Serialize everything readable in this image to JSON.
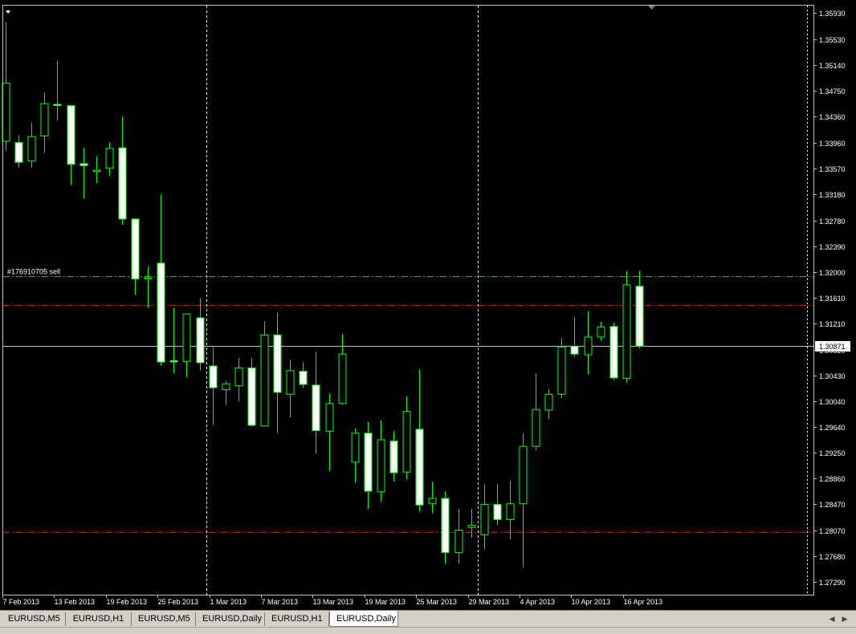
{
  "chart_data": {
    "type": "candlestick",
    "symbol": "EURUSD",
    "timeframe": "Daily",
    "y_ticks": [
      1.3593,
      1.3553,
      1.3514,
      1.3475,
      1.3436,
      1.3396,
      1.3357,
      1.3318,
      1.3278,
      1.3239,
      1.32,
      1.3161,
      1.3121,
      1.3082,
      1.3043,
      1.3004,
      1.2964,
      1.2925,
      1.2886,
      1.2847,
      1.2807,
      1.2768,
      1.2729
    ],
    "y_tick_labels": [
      "1.35930",
      "1.35530",
      "1.35140",
      "1.34750",
      "1.34360",
      "1.33960",
      "1.33570",
      "1.33180",
      "1.32780",
      "1.32390",
      "1.32000",
      "1.31610",
      "1.31210",
      "1.30820",
      "1.30430",
      "1.30040",
      "1.29640",
      "1.29250",
      "1.28860",
      "1.28470",
      "1.28070",
      "1.27680",
      "1.27290"
    ],
    "ylim": [
      1.271,
      1.3605
    ],
    "x_ticks": [
      {
        "index": 0,
        "label": "7 Feb 2013"
      },
      {
        "index": 4,
        "label": "13 Feb 2013"
      },
      {
        "index": 8,
        "label": "19 Feb 2013"
      },
      {
        "index": 12,
        "label": "25 Feb 2013"
      },
      {
        "index": 16,
        "label": "1 Mar 2013"
      },
      {
        "index": 20,
        "label": "7 Mar 2013"
      },
      {
        "index": 24,
        "label": "13 Mar 2013"
      },
      {
        "index": 28,
        "label": "19 Mar 2013"
      },
      {
        "index": 32,
        "label": "25 Mar 2013"
      },
      {
        "index": 36,
        "label": "29 Mar 2013"
      },
      {
        "index": 40,
        "label": "4 Apr 2013"
      },
      {
        "index": 44,
        "label": "10 Apr 2013"
      },
      {
        "index": 48,
        "label": "16 Apr 2013"
      }
    ],
    "candles": [
      {
        "o": 1.3398,
        "h": 1.3579,
        "l": 1.3384,
        "c": 1.3486
      },
      {
        "o": 1.3396,
        "h": 1.3407,
        "l": 1.3358,
        "c": 1.3366
      },
      {
        "o": 1.3368,
        "h": 1.3426,
        "l": 1.3358,
        "c": 1.3405
      },
      {
        "o": 1.3406,
        "h": 1.3472,
        "l": 1.338,
        "c": 1.3455
      },
      {
        "o": 1.3454,
        "h": 1.352,
        "l": 1.3429,
        "c": 1.3453
      },
      {
        "o": 1.3452,
        "h": 1.3453,
        "l": 1.3332,
        "c": 1.3363
      },
      {
        "o": 1.3364,
        "h": 1.3388,
        "l": 1.3311,
        "c": 1.3361
      },
      {
        "o": 1.3352,
        "h": 1.3375,
        "l": 1.3334,
        "c": 1.3354
      },
      {
        "o": 1.3357,
        "h": 1.3396,
        "l": 1.3345,
        "c": 1.3387
      },
      {
        "o": 1.3388,
        "h": 1.3435,
        "l": 1.3271,
        "c": 1.328
      },
      {
        "o": 1.328,
        "h": 1.3281,
        "l": 1.3165,
        "c": 1.3189
      },
      {
        "o": 1.3189,
        "h": 1.3208,
        "l": 1.3145,
        "c": 1.3191
      },
      {
        "o": 1.3213,
        "h": 1.3317,
        "l": 1.3058,
        "c": 1.3063
      },
      {
        "o": 1.3065,
        "h": 1.3145,
        "l": 1.3046,
        "c": 1.3065
      },
      {
        "o": 1.3064,
        "h": 1.3136,
        "l": 1.304,
        "c": 1.3136
      },
      {
        "o": 1.313,
        "h": 1.316,
        "l": 1.305,
        "c": 1.3062
      },
      {
        "o": 1.3057,
        "h": 1.3085,
        "l": 1.2968,
        "c": 1.3024
      },
      {
        "o": 1.3021,
        "h": 1.3034,
        "l": 1.2998,
        "c": 1.303
      },
      {
        "o": 1.3027,
        "h": 1.3069,
        "l": 1.3003,
        "c": 1.3054
      },
      {
        "o": 1.3054,
        "h": 1.3069,
        "l": 1.2965,
        "c": 1.2967
      },
      {
        "o": 1.2966,
        "h": 1.3124,
        "l": 1.2965,
        "c": 1.3104
      },
      {
        "o": 1.3104,
        "h": 1.3138,
        "l": 1.2955,
        "c": 1.3017
      },
      {
        "o": 1.3014,
        "h": 1.3066,
        "l": 1.2979,
        "c": 1.305
      },
      {
        "o": 1.3049,
        "h": 1.3063,
        "l": 1.3024,
        "c": 1.3029
      },
      {
        "o": 1.3028,
        "h": 1.3078,
        "l": 1.2924,
        "c": 1.2959
      },
      {
        "o": 1.2958,
        "h": 1.3015,
        "l": 1.2898,
        "c": 1.3
      },
      {
        "o": 1.3,
        "h": 1.3105,
        "l": 1.2998,
        "c": 1.3075
      },
      {
        "o": 1.2911,
        "h": 1.2962,
        "l": 1.288,
        "c": 1.2955
      },
      {
        "o": 1.2955,
        "h": 1.2972,
        "l": 1.284,
        "c": 1.2867
      },
      {
        "o": 1.2866,
        "h": 1.2975,
        "l": 1.2851,
        "c": 1.2945
      },
      {
        "o": 1.2943,
        "h": 1.2958,
        "l": 1.2882,
        "c": 1.2895
      },
      {
        "o": 1.2896,
        "h": 1.3011,
        "l": 1.2885,
        "c": 1.2988
      },
      {
        "o": 1.2961,
        "h": 1.3052,
        "l": 1.2836,
        "c": 1.2846
      },
      {
        "o": 1.2848,
        "h": 1.2881,
        "l": 1.2834,
        "c": 1.2856
      },
      {
        "o": 1.2856,
        "h": 1.2867,
        "l": 1.2757,
        "c": 1.2774
      },
      {
        "o": 1.2774,
        "h": 1.284,
        "l": 1.2757,
        "c": 1.2808
      },
      {
        "o": 1.2812,
        "h": 1.284,
        "l": 1.2796,
        "c": 1.2815
      },
      {
        "o": 1.2801,
        "h": 1.2878,
        "l": 1.2779,
        "c": 1.2847
      },
      {
        "o": 1.2847,
        "h": 1.2878,
        "l": 1.2815,
        "c": 1.2824
      },
      {
        "o": 1.2824,
        "h": 1.2883,
        "l": 1.2794,
        "c": 1.2848
      },
      {
        "o": 1.2848,
        "h": 1.2955,
        "l": 1.2751,
        "c": 1.2935
      },
      {
        "o": 1.2935,
        "h": 1.3046,
        "l": 1.2929,
        "c": 1.2991
      },
      {
        "o": 1.299,
        "h": 1.3022,
        "l": 1.2976,
        "c": 1.3014
      },
      {
        "o": 1.3014,
        "h": 1.3099,
        "l": 1.3008,
        "c": 1.3086
      },
      {
        "o": 1.3087,
        "h": 1.3131,
        "l": 1.3071,
        "c": 1.3075
      },
      {
        "o": 1.3074,
        "h": 1.314,
        "l": 1.3044,
        "c": 1.3101
      },
      {
        "o": 1.3101,
        "h": 1.3124,
        "l": 1.3095,
        "c": 1.3116
      },
      {
        "o": 1.3117,
        "h": 1.3123,
        "l": 1.3036,
        "c": 1.3039
      },
      {
        "o": 1.3038,
        "h": 1.3201,
        "l": 1.3032,
        "c": 1.318
      },
      {
        "o": 1.3178,
        "h": 1.3201,
        "l": 1.3084,
        "c": 1.3087
      }
    ],
    "bid_price": 1.30871,
    "bid_price_label": "1.30871",
    "lines": [
      {
        "kind": "order",
        "price": 1.3194,
        "color": "#00c000",
        "label": "#176910705 sell"
      },
      {
        "kind": "stop-level",
        "price": 1.315,
        "color": "#ff0000"
      },
      {
        "kind": "stop-level",
        "price": 1.2805,
        "color": "#ff0000"
      }
    ],
    "period_separators": [
      16,
      37
    ],
    "colors": {
      "background": "#000000",
      "bull_body": "#000000",
      "bear_body": "#ffffff",
      "wick": "#00ff00",
      "bid_line": "#c0c0c0",
      "axis_text": "#ffffff"
    }
  },
  "tabs": [
    {
      "label": "EURUSD,M5",
      "active": false
    },
    {
      "label": "EURUSD,H1",
      "active": false
    },
    {
      "label": "EURUSD,M5",
      "active": false
    },
    {
      "label": "EURUSD,Daily",
      "active": false
    },
    {
      "label": "EURUSD,H1",
      "active": false
    },
    {
      "label": "EURUSD,Daily",
      "active": true
    }
  ],
  "icons": {
    "chart_menu": "triangle-down-icon",
    "shift_marker": "triangle-down-icon",
    "tab_scroll_left": "arrow-left-icon",
    "tab_scroll_right": "arrow-right-icon"
  }
}
